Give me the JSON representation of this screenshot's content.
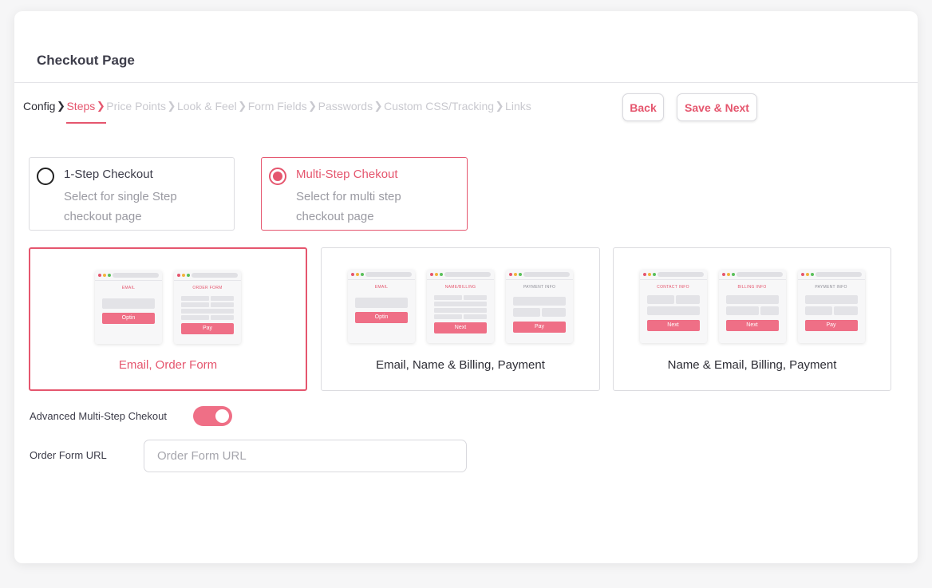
{
  "page": {
    "title": "Checkout Page"
  },
  "breadcrumb": [
    {
      "label": "Config",
      "state": "done"
    },
    {
      "label": "Steps",
      "state": "active"
    },
    {
      "label": "Price Points",
      "state": "pending"
    },
    {
      "label": "Look & Feel",
      "state": "pending"
    },
    {
      "label": "Form Fields",
      "state": "pending"
    },
    {
      "label": "Passwords",
      "state": "pending"
    },
    {
      "label": "Custom CSS/Tracking",
      "state": "pending"
    },
    {
      "label": "Links",
      "state": "pending"
    }
  ],
  "actions": {
    "back": "Back",
    "save_next": "Save & Next"
  },
  "checkout_types": [
    {
      "title": "1-Step Checkout",
      "description": "Select for single Step checkout page",
      "selected": false
    },
    {
      "title": "Multi-Step Chekout",
      "description": "Select for multi step checkout page",
      "selected": true
    }
  ],
  "templates": [
    {
      "label": "Email, Order Form",
      "selected": true,
      "thumbs": [
        {
          "caption": "EMAIL",
          "button": "Optin"
        },
        {
          "caption": "ORDER FORM",
          "button": "Pay"
        }
      ]
    },
    {
      "label": "Email, Name & Billing, Payment",
      "selected": false,
      "thumbs": [
        {
          "caption": "EMAIL",
          "button": "Optin"
        },
        {
          "caption": "NAME/BILLING",
          "button": "Next"
        },
        {
          "caption": "PAYMENT INFO",
          "button": "Pay"
        }
      ]
    },
    {
      "label": "Name & Email, Billing, Payment",
      "selected": false,
      "thumbs": [
        {
          "caption": "CONTACT INFO",
          "button": "Next"
        },
        {
          "caption": "BILLING INFO",
          "button": "Next"
        },
        {
          "caption": "PAYMENT INFO",
          "button": "Pay"
        }
      ]
    }
  ],
  "advanced": {
    "label": "Advanced Multi-Step Chekout",
    "enabled": true
  },
  "order_form_url": {
    "label": "Order Form URL",
    "value": "",
    "placeholder": "Order Form URL"
  },
  "colors": {
    "accent": "#e5566e",
    "accent_light": "#ef6f86"
  }
}
